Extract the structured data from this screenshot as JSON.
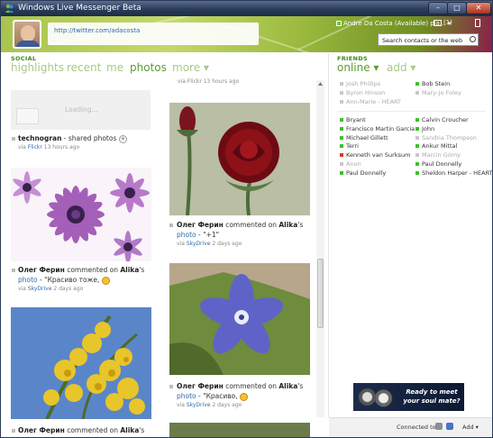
{
  "window": {
    "title": "Windows Live Messenger Beta",
    "btn_min": "–",
    "btn_max": "□",
    "btn_close": "✕"
  },
  "header": {
    "status_message": "http://twitter.com/adacosta",
    "user_name": "Andre Da Costa (Available)",
    "user_name_suffix": "pla...",
    "mail_count": "(1)",
    "search_placeholder": "Search contacts or the web"
  },
  "social": {
    "heading": "SOCIAL",
    "tabs": [
      {
        "label": "highlights",
        "active": false
      },
      {
        "label": "recent",
        "active": false
      },
      {
        "label": "me",
        "active": false
      },
      {
        "label": "photos",
        "active": true
      },
      {
        "label": "more ▾",
        "active": false
      }
    ]
  },
  "feed": {
    "top_meta": "via Flickr 13 hours ago",
    "loading_text": "Loading...",
    "items": [
      {
        "actor": "technogran",
        "text": " - shared photos ",
        "plus": "+",
        "meta_via": "via ",
        "meta_source": "Flickr",
        "meta_time": " 13 hours ago"
      },
      {
        "actor": "Олег Ферин",
        "text": " commented on ",
        "target": "Alika",
        "possessive": "'s",
        "link": "photo",
        "quote": " - \"+1\"",
        "meta_via": "via ",
        "meta_source": "SkyDrive",
        "meta_time": " 2 days ago"
      },
      {
        "actor": "Олег Ферин",
        "text": " commented on ",
        "target": "Alika",
        "possessive": "'s",
        "link": "photo",
        "quote": " - \"Красиво тоже, ",
        "meta_via": "via ",
        "meta_source": "SkyDrive",
        "meta_time": " 2 days ago"
      },
      {
        "actor": "Олег Ферин",
        "text": " commented on ",
        "target": "Alika",
        "possessive": "'s",
        "link": "photo",
        "quote": " - \"Красиво, ",
        "meta_via": "via ",
        "meta_source": "SkyDrive",
        "meta_time": " 2 days ago"
      },
      {
        "actor": "Олег Ферин",
        "text": " commented on ",
        "target": "Alika",
        "possessive": "'s"
      }
    ]
  },
  "friends": {
    "heading": "FRIENDS",
    "tab_online": "online ▾",
    "tab_add": "add ▾",
    "group1_left": [
      {
        "name": "Josh Phillips",
        "status": "offline"
      },
      {
        "name": "Byron Hinson",
        "status": "offline"
      },
      {
        "name": "Ann-Marie - HEART",
        "status": "offline"
      }
    ],
    "group1_right": [
      {
        "name": "Bob Stein",
        "status": "online"
      },
      {
        "name": "Mary-Jo Foley",
        "status": "offline"
      }
    ],
    "group2_left": [
      {
        "name": "Bryant",
        "status": "online"
      },
      {
        "name": "Francisco Martin Garcia",
        "status": "online"
      },
      {
        "name": "Michael Gillett",
        "status": "online"
      },
      {
        "name": "Terri",
        "status": "online"
      },
      {
        "name": "Kenneth van Surksum",
        "status": "busy"
      },
      {
        "name": "Anon",
        "status": "offline"
      },
      {
        "name": "Paul Donnelly",
        "status": "online"
      }
    ],
    "group2_right": [
      {
        "name": "Calvin Croucher",
        "status": "online"
      },
      {
        "name": "John",
        "status": "online"
      },
      {
        "name": "Sandria Thompson",
        "status": "offline"
      },
      {
        "name": "Ankur Mittal",
        "status": "online"
      },
      {
        "name": "Marcin Gómy",
        "status": "offline"
      },
      {
        "name": "Paul Donnelly",
        "status": "online"
      },
      {
        "name": "Sheldon Harper - HEART",
        "status": "online"
      }
    ]
  },
  "ad": {
    "line1": "Ready to meet",
    "line2": "your soul mate?"
  },
  "footer": {
    "connected_to": "Connected to",
    "add_label": "Add ▾"
  },
  "colors": {
    "accent_green": "#5c9b35",
    "light_green": "#a7c986",
    "link_blue": "#2b6ab0",
    "online": "#3fbf2c",
    "busy": "#d33a2c",
    "offline": "#c8c8c8"
  }
}
